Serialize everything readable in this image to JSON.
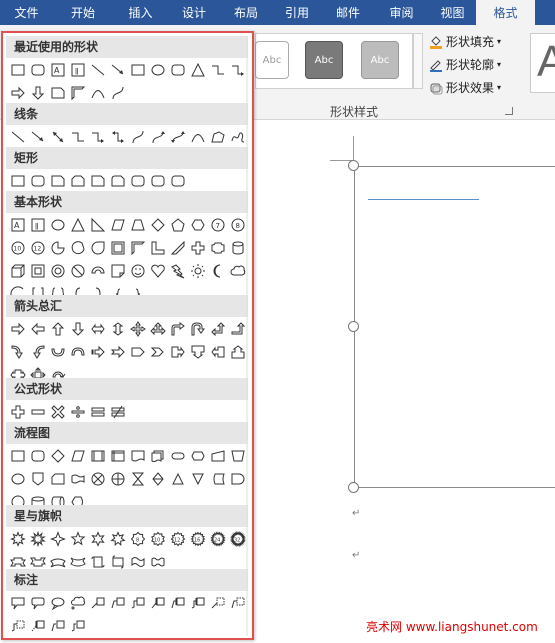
{
  "tabs": [
    {
      "label": "文件"
    },
    {
      "label": "开始"
    },
    {
      "label": "插入"
    },
    {
      "label": "设计"
    },
    {
      "label": "布局"
    },
    {
      "label": "引用"
    },
    {
      "label": "邮件"
    },
    {
      "label": "审阅"
    },
    {
      "label": "视图"
    },
    {
      "label": "格式",
      "active": true
    }
  ],
  "ribbon": {
    "style_boxes": [
      {
        "label": "Abc"
      },
      {
        "label": "Abc"
      },
      {
        "label": "Abc"
      }
    ],
    "commands": {
      "fill": "形状填充",
      "outline": "形状轮廓",
      "effects": "形状效果"
    },
    "group_label": "形状样式",
    "wordart_letter": "A"
  },
  "panel": {
    "sections": [
      {
        "title": "最近使用的形状"
      },
      {
        "title": "线条"
      },
      {
        "title": "矩形"
      },
      {
        "title": "基本形状"
      },
      {
        "title": "箭头总汇"
      },
      {
        "title": "公式形状"
      },
      {
        "title": "流程图"
      },
      {
        "title": "星与旗帜"
      },
      {
        "title": "标注"
      }
    ]
  },
  "document": {
    "paragraph_mark": "↵"
  },
  "watermark": "亮术网 www.liangshunet.com",
  "colors": {
    "tab_bar": "#2b579a",
    "panel_border": "#e05050",
    "watermark": "#dd0000"
  }
}
